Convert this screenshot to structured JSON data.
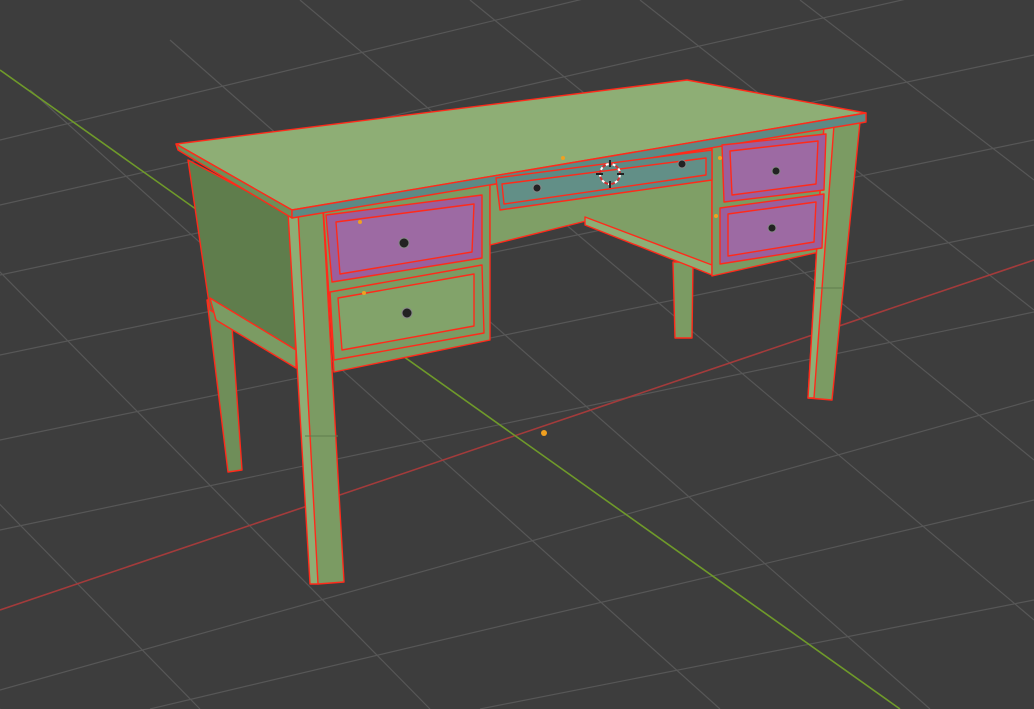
{
  "viewport": {
    "background": "#3d3d3d",
    "grid_color": "#555555",
    "x_axis_color": "#a33b3b",
    "y_axis_color": "#6f9a2a",
    "origin_color": "#f0a020"
  },
  "scene": {
    "object_color": "#7b9b63",
    "object_color_dark": "#5f7d4c",
    "object_color_light": "#8eae75",
    "selected_face_color": "#9a5f9c",
    "edge_color": "#ff2a1a",
    "drawer_mid_color": "#587f78",
    "handle_color": "#222222",
    "cursor_icon": "3d-cursor-icon"
  }
}
